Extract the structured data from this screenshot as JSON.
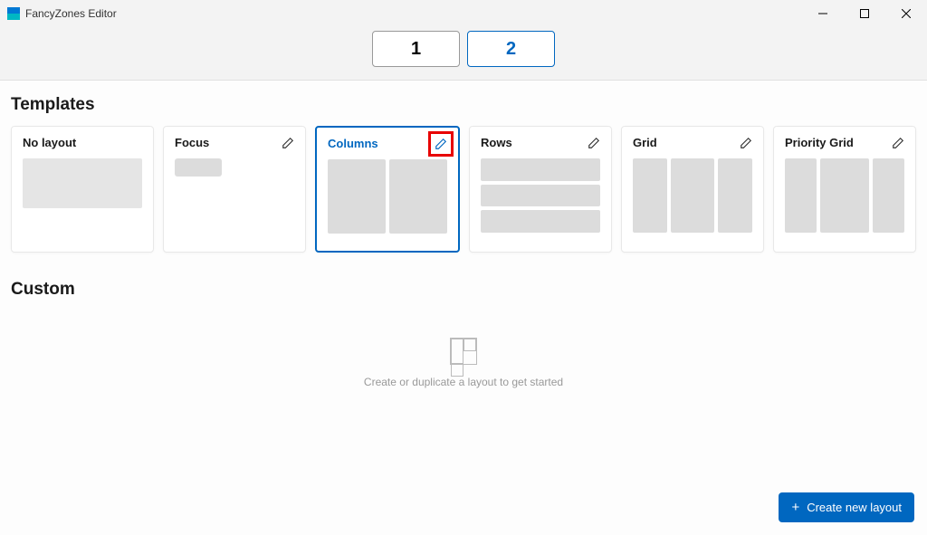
{
  "title": "FancyZones Editor",
  "monitors": {
    "tabs": [
      "1",
      "2"
    ],
    "selected": 1
  },
  "sections": {
    "templates": "Templates",
    "custom": "Custom"
  },
  "templates": [
    {
      "name": "No layout"
    },
    {
      "name": "Focus"
    },
    {
      "name": "Columns",
      "selected": true,
      "highlight_edit": true
    },
    {
      "name": "Rows"
    },
    {
      "name": "Grid"
    },
    {
      "name": "Priority Grid"
    }
  ],
  "custom_empty": "Create or duplicate a layout to get started",
  "create_button": "Create new layout"
}
